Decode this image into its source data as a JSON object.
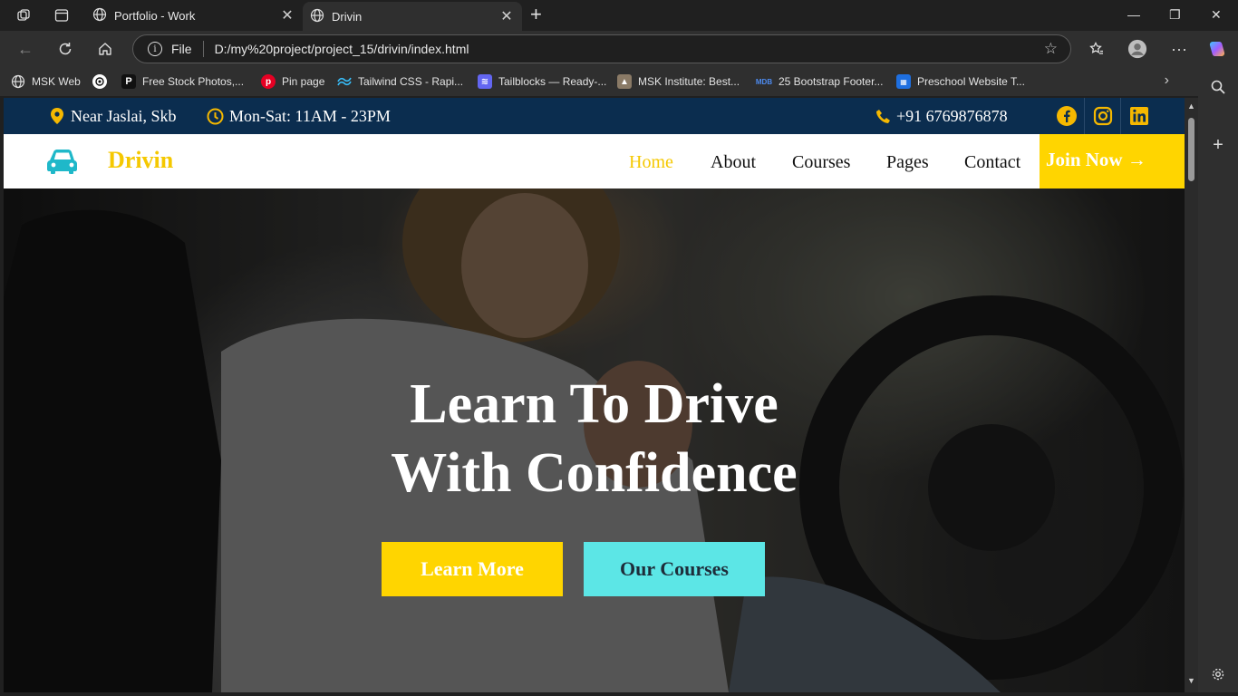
{
  "browser": {
    "tabs": [
      {
        "title": "Portfolio - Work"
      },
      {
        "title": "Drivin"
      }
    ],
    "address": {
      "scheme_label": "File",
      "url": "D:/my%20project/project_15/drivin/index.html"
    },
    "bookmarks": [
      {
        "label": "MSK Web",
        "icon": "globe-icon"
      },
      {
        "label": "",
        "icon": "openai-icon"
      },
      {
        "label": "Free Stock Photos,...",
        "icon": "pexels-icon"
      },
      {
        "label": "Pin page",
        "icon": "pinterest-icon"
      },
      {
        "label": "Tailwind CSS - Rapi...",
        "icon": "tailwind-icon"
      },
      {
        "label": "Tailblocks — Ready-...",
        "icon": "tailblocks-icon"
      },
      {
        "label": "MSK Institute: Best...",
        "icon": "institute-icon"
      },
      {
        "label": "25 Bootstrap Footer...",
        "icon": "mdb-icon"
      },
      {
        "label": "Preschool Website T...",
        "icon": "preschool-icon"
      }
    ]
  },
  "site": {
    "topbar": {
      "location": "Near Jaslai, Skb",
      "hours": "Mon-Sat: 11AM - 23PM",
      "phone": "+91 6769876878",
      "social": [
        "facebook-icon",
        "instagram-icon",
        "linkedin-icon"
      ]
    },
    "brand": "Drivin",
    "nav": {
      "home": "Home",
      "about": "About",
      "courses": "Courses",
      "pages": "Pages",
      "contact": "Contact",
      "join": "Join Now →"
    },
    "hero": {
      "title_line1": "Learn To Drive",
      "title_line2": "With Confidence",
      "btn_primary": "Learn More",
      "btn_secondary": "Our Courses"
    }
  },
  "colors": {
    "topbar_bg": "#0b2d4f",
    "accent_yellow": "#ffd500",
    "accent_cyan": "#5ce6e6",
    "logo_teal": "#1fb8c9"
  }
}
